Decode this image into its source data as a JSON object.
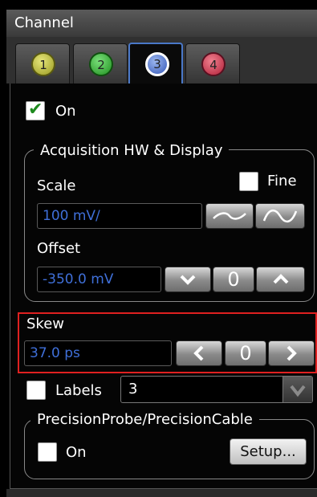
{
  "title": "Channel",
  "tabs": [
    {
      "label": "1",
      "color": "#b5b53a",
      "active": false
    },
    {
      "label": "2",
      "color": "#2fa52f",
      "active": false
    },
    {
      "label": "3",
      "color": "#3f63c8",
      "active": true
    },
    {
      "label": "4",
      "color": "#c8324a",
      "active": false
    }
  ],
  "on": {
    "label": "On",
    "checked": true
  },
  "acq": {
    "legend": "Acquisition HW & Display",
    "scale_label": "Scale",
    "fine_label": "Fine",
    "fine_checked": false,
    "scale_value": "100 mV/",
    "offset_label": "Offset",
    "offset_value": "-350.0 mV"
  },
  "skew": {
    "label": "Skew",
    "value": "37.0 ps",
    "zero": "0"
  },
  "offset_zero": "0",
  "labels": {
    "label": "Labels",
    "checked": false,
    "value": "3"
  },
  "precision": {
    "legend": "PrecisionProbe/PrecisionCable",
    "on_label": "On",
    "checked": false,
    "setup": "Setup..."
  },
  "icons": [
    "checkmark-icon",
    "coarse-wave-icon",
    "fine-wave-icon",
    "chevron-down-icon",
    "chevron-up-icon",
    "chevron-left-icon",
    "chevron-right-icon"
  ]
}
